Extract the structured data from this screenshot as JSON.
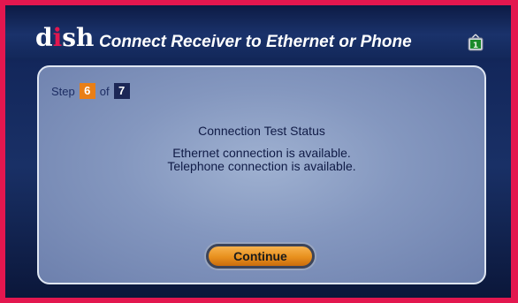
{
  "header": {
    "logo_text": "dish",
    "title": "Connect Receiver to Ethernet or Phone",
    "icons": [
      "tv-icon"
    ]
  },
  "step": {
    "prefix": "Step",
    "current": "6",
    "separator": "of",
    "total": "7"
  },
  "content": {
    "heading": "Connection Test Status",
    "lines": [
      "Ethernet connection is available.",
      "Telephone connection is available."
    ]
  },
  "actions": {
    "continue_label": "Continue"
  },
  "colors": {
    "frame": "#e3174f",
    "accent": "#e97f16",
    "panel": "#8a9cc3",
    "header": "#13285a"
  }
}
